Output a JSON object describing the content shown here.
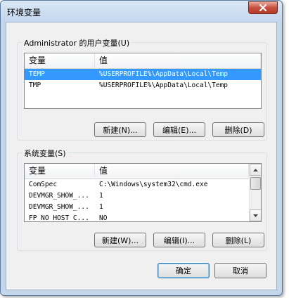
{
  "window": {
    "title": "环境变量",
    "close_glyph": "✕"
  },
  "user_vars": {
    "label": "Administrator 的用户变量(U)",
    "columns": [
      "变量",
      "值"
    ],
    "rows": [
      {
        "name": "TEMP",
        "value": "%USERPROFILE%\\AppData\\Local\\Temp",
        "selected": true
      },
      {
        "name": "TMP",
        "value": "%USERPROFILE%\\AppData\\Local\\Temp",
        "selected": false
      }
    ],
    "new_label": "新建(N)...",
    "edit_label": "编辑(E)...",
    "delete_label": "删除(D)"
  },
  "system_vars": {
    "label": "系统变量(S)",
    "columns": [
      "变量",
      "值"
    ],
    "rows": [
      {
        "name": "ComSpec",
        "value": "C:\\Windows\\system32\\cmd.exe"
      },
      {
        "name": "DEVMGR_SHOW_...",
        "value": "1"
      },
      {
        "name": "DEVMGR_SHOW_...",
        "value": "1"
      },
      {
        "name": "FP_NO_HOST_C...",
        "value": "NO"
      }
    ],
    "new_label": "新建(W)...",
    "edit_label": "编辑(I)...",
    "delete_label": "删除(L)"
  },
  "footer": {
    "ok_label": "确定",
    "cancel_label": "取消"
  },
  "colors": {
    "selection": "#3399ff",
    "frame": "#c4d6ea",
    "close": "#c7503e"
  }
}
